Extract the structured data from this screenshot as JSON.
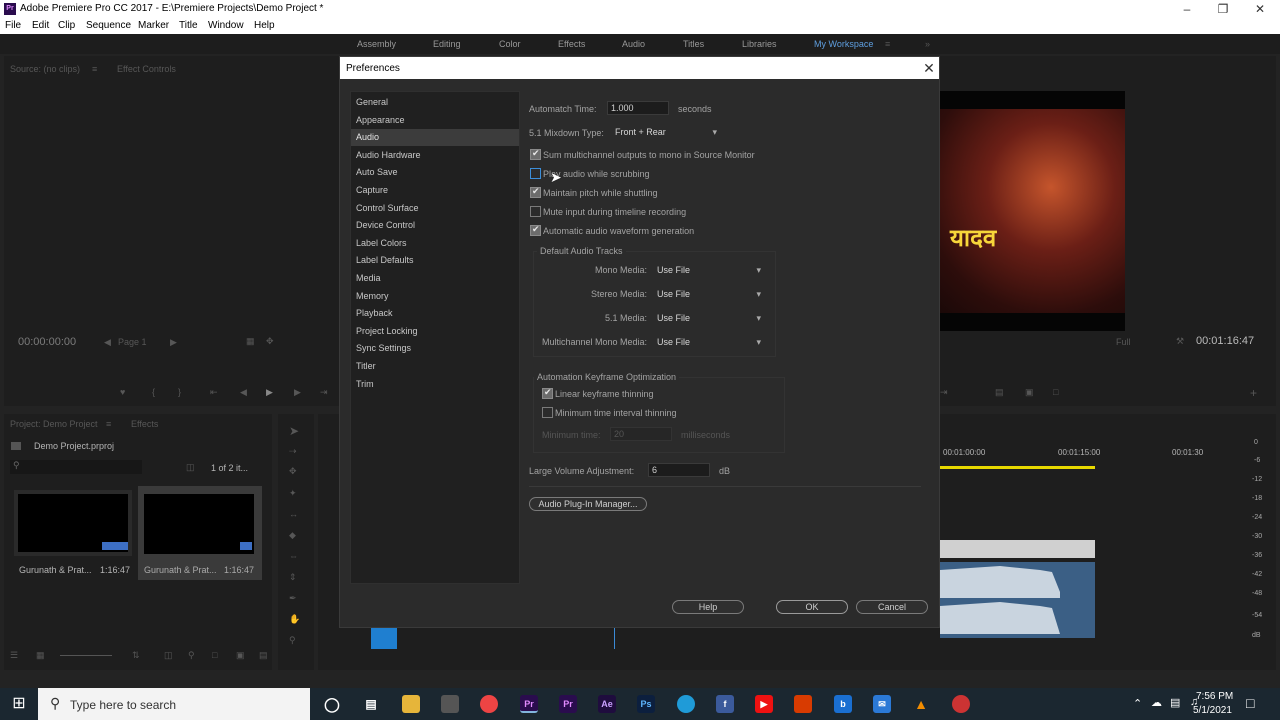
{
  "window": {
    "title": "Adobe Premiere Pro CC 2017 - E:\\Premiere Projects\\Demo Project *",
    "app_badge": "Pr"
  },
  "menu": [
    "File",
    "Edit",
    "Clip",
    "Sequence",
    "Marker",
    "Title",
    "Window",
    "Help"
  ],
  "workspaces": {
    "items": [
      "Assembly",
      "Editing",
      "Color",
      "Effects",
      "Audio",
      "Titles",
      "Libraries",
      "My Workspace"
    ],
    "more": "»"
  },
  "source_panel": {
    "tab1": "Source: (no clips)",
    "tab2": "Effect Controls",
    "timecode": "00:00:00:00",
    "page": "Page 1"
  },
  "program_panel": {
    "overlay_text": "यादव",
    "zoom": "Full",
    "timecode": "00:01:16:47"
  },
  "project_panel": {
    "tab1": "Project: Demo Project",
    "tab2": "Effects",
    "file": "Demo Project.prproj",
    "count": "1 of 2 it...",
    "clips": [
      {
        "name": "Gurunath & Prat...",
        "duration": "1:16:47"
      },
      {
        "name": "Gurunath & Prat...",
        "duration": "1:16:47"
      }
    ]
  },
  "timeline": {
    "ticks": [
      "00:01:00:00",
      "00:01:15:00",
      "00:01:30"
    ],
    "meter_labels": [
      "0",
      "-6",
      "-12",
      "-18",
      "-24",
      "-30",
      "-36",
      "-42",
      "-48",
      "-54",
      "dB"
    ]
  },
  "dialog": {
    "title": "Preferences",
    "categories": [
      "General",
      "Appearance",
      "Audio",
      "Audio Hardware",
      "Auto Save",
      "Capture",
      "Control Surface",
      "Device Control",
      "Label Colors",
      "Label Defaults",
      "Media",
      "Memory",
      "Playback",
      "Project Locking",
      "Sync Settings",
      "Titler",
      "Trim"
    ],
    "selected_category": "Audio",
    "automatch": {
      "label": "Automatch Time:",
      "value": "1.000",
      "unit": "seconds"
    },
    "mixdown": {
      "label": "5.1 Mixdown Type:",
      "value": "Front + Rear"
    },
    "checks": [
      {
        "label": "Sum multichannel outputs to mono in Source Monitor",
        "checked": true
      },
      {
        "label": "Play audio while scrubbing",
        "checked": false
      },
      {
        "label": "Maintain pitch while shuttling",
        "checked": true
      },
      {
        "label": "Mute input during timeline recording",
        "checked": false
      },
      {
        "label": "Automatic audio waveform generation",
        "checked": true
      }
    ],
    "default_tracks": {
      "title": "Default Audio Tracks",
      "rows": [
        {
          "label": "Mono Media:",
          "value": "Use File"
        },
        {
          "label": "Stereo Media:",
          "value": "Use File"
        },
        {
          "label": "5.1 Media:",
          "value": "Use File"
        },
        {
          "label": "Multichannel Mono Media:",
          "value": "Use File"
        }
      ]
    },
    "keyframe": {
      "title": "Automation Keyframe Optimization",
      "linear": "Linear keyframe thinning",
      "linear_checked": true,
      "mintime": "Minimum time interval thinning",
      "mintime_checked": false,
      "min_label": "Minimum time:",
      "min_value": "20",
      "min_unit": "milliseconds"
    },
    "large_volume": {
      "label": "Large Volume Adjustment:",
      "value": "6",
      "unit": "dB"
    },
    "plugin_button": "Audio Plug-In Manager...",
    "help": "Help",
    "ok": "OK",
    "cancel": "Cancel"
  },
  "taskbar": {
    "search": "Type here to search",
    "time": "7:56 PM",
    "date": "5/1/2021"
  }
}
